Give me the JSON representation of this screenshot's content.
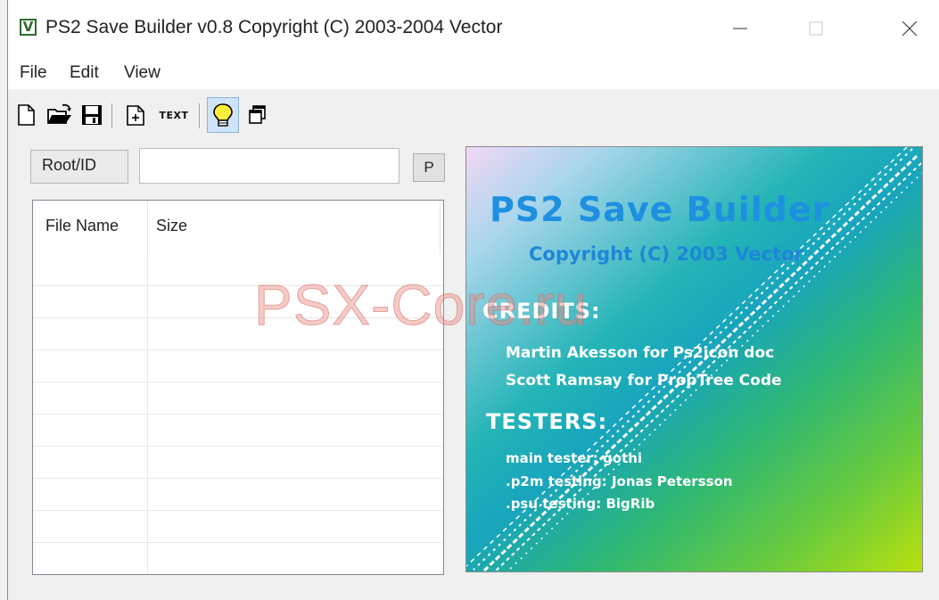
{
  "window": {
    "icon_letter": "V",
    "title": "PS2 Save Builder v0.8 Copyright (C) 2003-2004 Vector"
  },
  "menu": {
    "items": [
      "File",
      "Edit",
      "View"
    ]
  },
  "toolbar": {
    "buttons": [
      "new-file-icon",
      "open-folder-icon",
      "save-disk-icon",
      "add-file-icon",
      "text-icon",
      "lightbulb-icon",
      "copy-windows-icon"
    ],
    "text_label": "TEXT",
    "active_button": "lightbulb-icon"
  },
  "rootid": {
    "label": "Root/ID",
    "value": "",
    "button_label": "P"
  },
  "filelist": {
    "columns": [
      "File Name",
      "Size"
    ],
    "rows": []
  },
  "about": {
    "title": "PS2 Save Builder",
    "copyright": "Copyright (C) 2003 Vector",
    "credits_heading": "CREDITS:",
    "credits": [
      "Martin Akesson for Ps2icon doc",
      "Scott Ramsay for PropTree Code"
    ],
    "testers_heading": "TESTERS:",
    "testers": [
      "main tester: gothi",
      ".p2m testing: Jonas Petersson",
      ".psu testing: BigRib"
    ]
  },
  "watermark": "PSX-Core.ru",
  "colors": {
    "about_title": "#1e90e0",
    "toolbar_active_bg": "#cfe4f8",
    "icon_green": "#2d6b2d"
  }
}
